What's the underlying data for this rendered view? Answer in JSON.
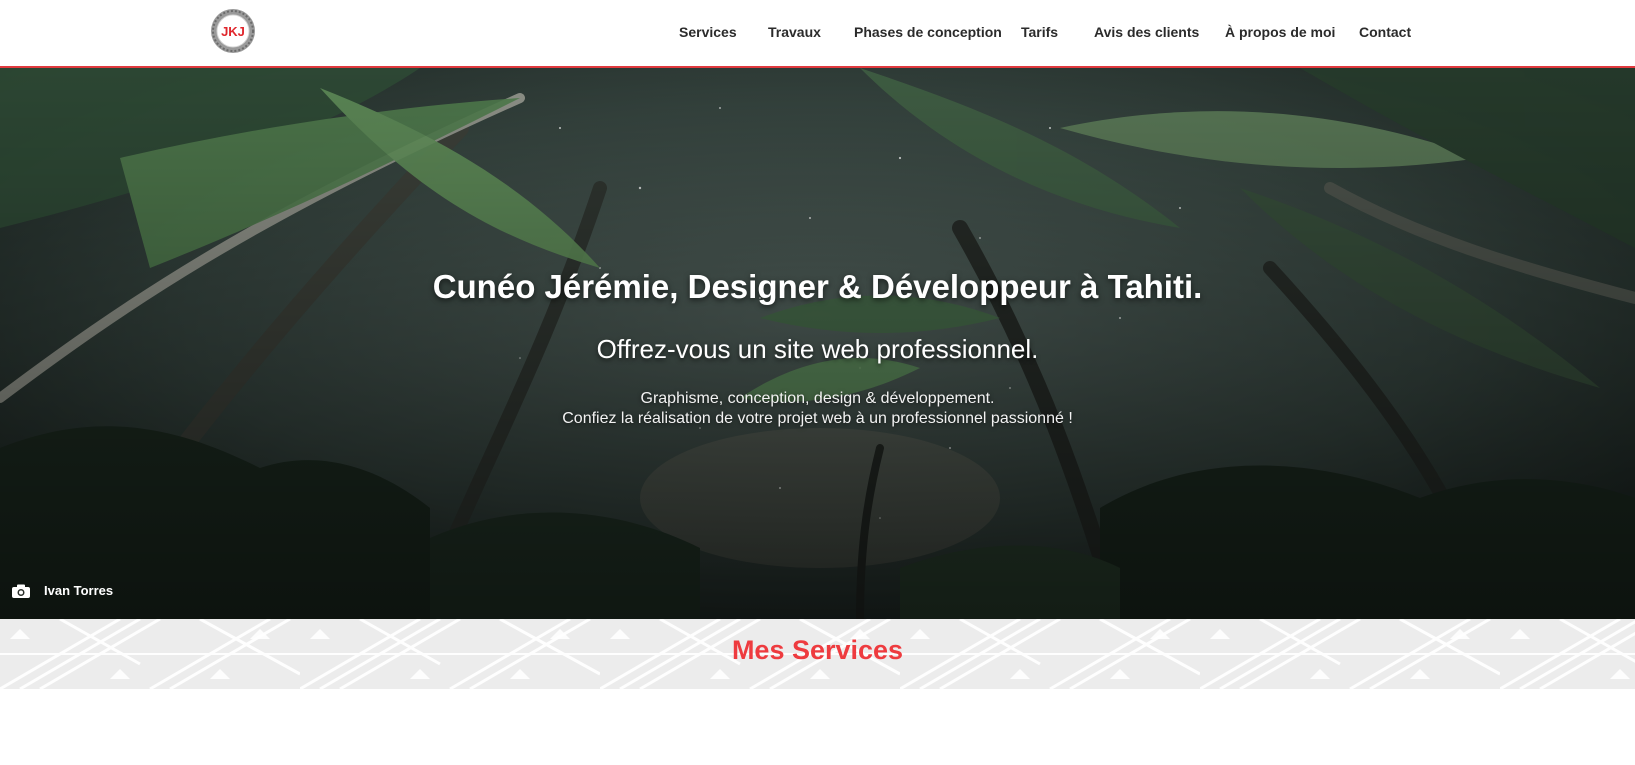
{
  "header": {
    "logo_text": "JKJ",
    "nav": [
      {
        "label": "Services"
      },
      {
        "label": "Travaux"
      },
      {
        "label": "Phases de conception"
      },
      {
        "label": "Tarifs"
      },
      {
        "label": "Avis des clients"
      },
      {
        "label": "À propos de moi"
      },
      {
        "label": "Contact"
      }
    ]
  },
  "hero": {
    "title": "Cunéo Jérémie, Designer & Développeur à Tahiti.",
    "subtitle": "Offrez-vous un site web professionnel.",
    "line1": "Graphisme, conception, design & développement.",
    "line2": "Confiez la réalisation de votre projet web à un professionnel passionné !",
    "photo_credit": "Ivan Torres",
    "credit_icon": "camera-icon"
  },
  "services": {
    "title": "Mes Services"
  },
  "colors": {
    "accent": "#ee3b3f",
    "nav_text": "#2b2b2b",
    "band_bg": "#ededed"
  }
}
